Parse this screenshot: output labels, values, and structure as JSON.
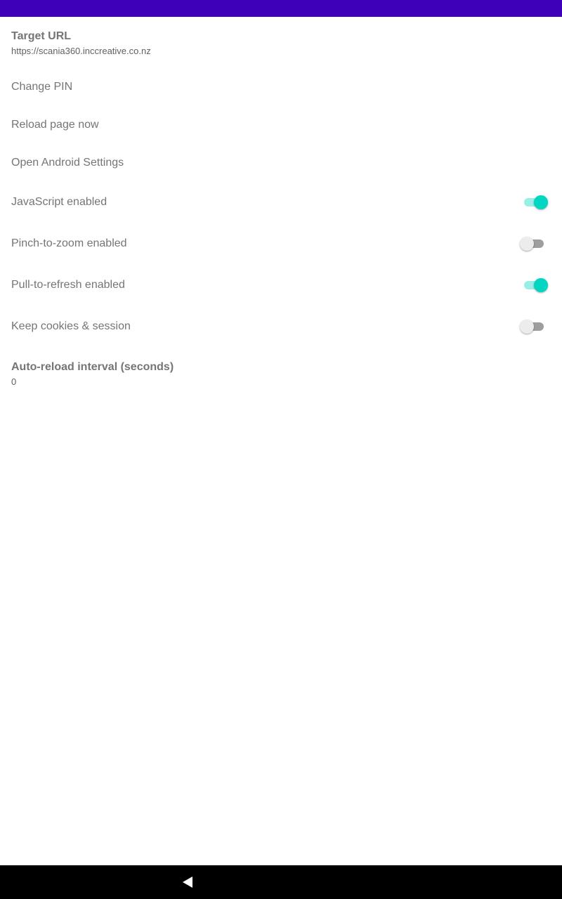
{
  "colors": {
    "status_bar": "#3F00BA",
    "nav_bar": "#000000",
    "switch_on": "#00D6C1",
    "switch_off_thumb": "#ECECEC",
    "switch_off_track": "#9E9E9E"
  },
  "settings": {
    "target_url": {
      "title": "Target URL",
      "summary": "https://scania360.inccreative.co.nz"
    },
    "change_pin": {
      "title": "Change PIN"
    },
    "reload_page": {
      "title": "Reload page now"
    },
    "open_android_settings": {
      "title": "Open Android Settings"
    },
    "javascript": {
      "title": "JavaScript enabled",
      "enabled": true
    },
    "pinch_zoom": {
      "title": "Pinch-to-zoom enabled",
      "enabled": false
    },
    "pull_refresh": {
      "title": "Pull-to-refresh enabled",
      "enabled": true
    },
    "keep_cookies": {
      "title": "Keep cookies & session",
      "enabled": false
    },
    "auto_reload": {
      "title": "Auto-reload interval (seconds)",
      "summary": "0"
    }
  },
  "nav": {
    "back_icon": "back-triangle-icon"
  }
}
